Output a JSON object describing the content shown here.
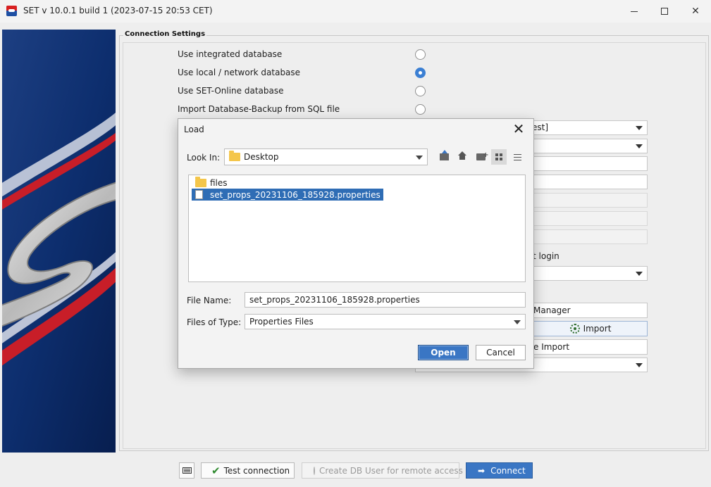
{
  "window": {
    "title": "SET v 10.0.1 build 1 (2023-07-15 20:53 CET)",
    "minimize_icon": "minimize-icon",
    "maximize_icon": "maximize-icon",
    "close_icon": "close-icon"
  },
  "connection_settings": {
    "title": "Connection Settings",
    "options": [
      {
        "label": "Use integrated database",
        "checked": false
      },
      {
        "label": "Use local / network database",
        "checked": true
      },
      {
        "label": "Use SET-Online database",
        "checked": false
      },
      {
        "label": "Import Database-Backup from SQL file",
        "checked": false
      }
    ],
    "partial_texts": {
      "combo_1": "est]",
      "login_text": "t login",
      "manager_button": "Manager",
      "import_button": "Import",
      "import_button_2": "e Import"
    }
  },
  "bottom_bar": {
    "test_connection": "Test connection",
    "create_db_user": "Create DB User for remote access",
    "connect": "Connect"
  },
  "load_dialog": {
    "title": "Load",
    "look_in_label": "Look In:",
    "look_in_value": "Desktop",
    "files": [
      {
        "name": "files",
        "type": "folder",
        "selected": false
      },
      {
        "name": "set_props_20231106_185928.properties",
        "type": "file",
        "selected": true
      }
    ],
    "file_name_label": "File Name:",
    "file_name_value": "set_props_20231106_185928.properties",
    "files_of_type_label": "Files of Type:",
    "files_of_type_value": "Properties Files",
    "open_button": "Open",
    "cancel_button": "Cancel",
    "close_glyph": "✕"
  },
  "colors": {
    "accent": "#3a76c4",
    "selection": "#2f6db5",
    "folder": "#f4c64b"
  }
}
